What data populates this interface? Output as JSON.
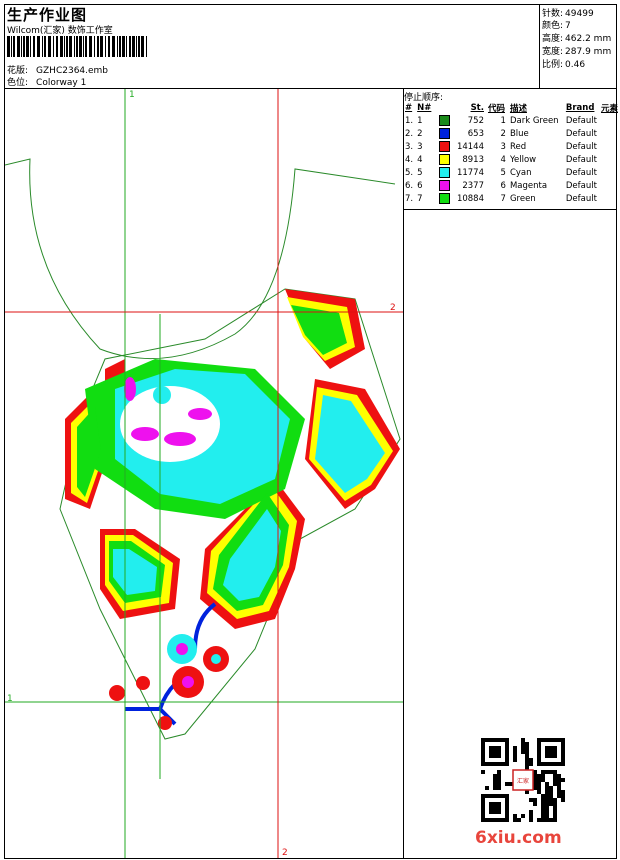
{
  "header": {
    "title": "生产作业图",
    "studio": "Wilcom(汇家) 数饰工作室",
    "design_label": "花版:",
    "design_value": "GZHC2364.emb",
    "colorway_label": "色位:",
    "colorway_value": "Colorway 1"
  },
  "stats": [
    {
      "label": "针数:",
      "value": "49499"
    },
    {
      "label": "颜色:",
      "value": "7"
    },
    {
      "label": "高度:",
      "value": "462.2 mm"
    },
    {
      "label": "宽度:",
      "value": "287.9 mm"
    },
    {
      "label": "比例:",
      "value": "0.46"
    }
  ],
  "stop_sequence": {
    "title": "停止顺序:",
    "headers": [
      "#",
      "N#",
      "St.",
      "代码",
      "描述",
      "Brand",
      "元素"
    ],
    "rows": [
      {
        "idx": "1.",
        "n": "1",
        "color": "#1a8a1a",
        "stitches": "752",
        "code": "1",
        "desc": "Dark Green",
        "brand": "Default"
      },
      {
        "idx": "2.",
        "n": "2",
        "color": "#0022dd",
        "stitches": "653",
        "code": "2",
        "desc": "Blue",
        "brand": "Default"
      },
      {
        "idx": "3.",
        "n": "3",
        "color": "#ee1111",
        "stitches": "14144",
        "code": "3",
        "desc": "Red",
        "brand": "Default"
      },
      {
        "idx": "4.",
        "n": "4",
        "color": "#ffff00",
        "stitches": "8913",
        "code": "4",
        "desc": "Yellow",
        "brand": "Default"
      },
      {
        "idx": "5.",
        "n": "5",
        "color": "#22eeee",
        "stitches": "11774",
        "code": "5",
        "desc": "Cyan",
        "brand": "Default"
      },
      {
        "idx": "6.",
        "n": "6",
        "color": "#ee11ee",
        "stitches": "2377",
        "code": "6",
        "desc": "Magenta",
        "brand": "Default"
      },
      {
        "idx": "7.",
        "n": "7",
        "color": "#11dd11",
        "stitches": "10884",
        "code": "7",
        "desc": "Green",
        "brand": "Default"
      }
    ]
  },
  "guides": {
    "green_v": "1",
    "green_h": "1",
    "red_v": "2",
    "red_h": "2"
  },
  "watermark": "6xiu.com",
  "stamp_text": "汇家"
}
